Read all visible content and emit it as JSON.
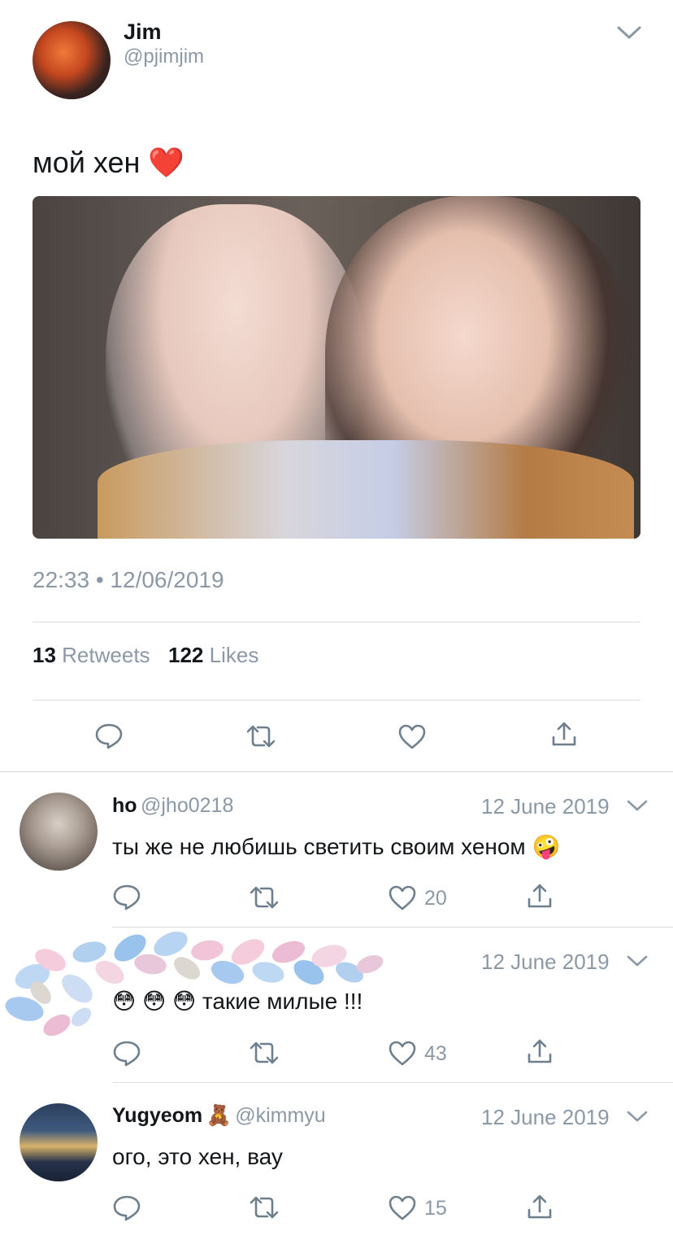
{
  "tweet": {
    "author_name": "Jim",
    "author_handle": "@pjimjim",
    "text": "мой хен",
    "text_emoji": "❤️",
    "timestamp": "22:33 • 12/06/2019",
    "retweets_count": "13",
    "retweets_label": "Retweets",
    "likes_count": "122",
    "likes_label": "Likes"
  },
  "replies": [
    {
      "name": "ho",
      "handle": "@jho0218",
      "date": "12 June 2019",
      "text": "ты же не любишь светить своим хеном",
      "text_emoji": "🤪",
      "likes": "20"
    },
    {
      "name": "",
      "handle": "",
      "date": "12 June 2019",
      "emoji_prefix": "😳 😳 😳",
      "text": "такие милые !!!",
      "likes": "43"
    },
    {
      "name": "Yugyeom",
      "name_emoji": "🧸",
      "handle": "@kimmyu",
      "date": "12 June 2019",
      "text": "ого, это хен, вау",
      "likes": "15"
    }
  ],
  "colors": {
    "text": "#14171a",
    "muted": "#8b98a5",
    "divider": "#dcdfe2",
    "icon": "#6e7f8d"
  },
  "icons": [
    "chevron-down-icon",
    "reply-icon",
    "retweet-icon",
    "like-icon",
    "share-icon"
  ]
}
